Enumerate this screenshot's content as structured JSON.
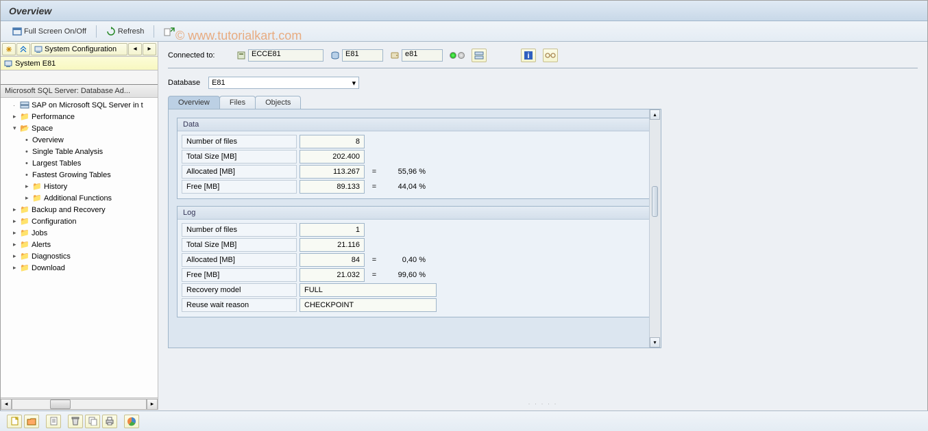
{
  "title": "Overview",
  "toolbar": {
    "fullscreen": "Full Screen On/Off",
    "refresh": "Refresh"
  },
  "sidebar": {
    "sys_config": "System Configuration",
    "system": "System E81",
    "tree_header": "Microsoft SQL Server: Database Ad...",
    "nodes": {
      "top": "SAP on Microsoft SQL Server in t",
      "performance": "Performance",
      "space": "Space",
      "overview": "Overview",
      "single_table": "Single Table Analysis",
      "largest": "Largest Tables",
      "fastest": "Fastest Growing Tables",
      "history": "History",
      "additional": "Additional Functions",
      "backup": "Backup and Recovery",
      "configuration": "Configuration",
      "jobs": "Jobs",
      "alerts": "Alerts",
      "diagnostics": "Diagnostics",
      "download": "Download"
    }
  },
  "conn": {
    "label": "Connected to:",
    "field1": "ECCE81",
    "field2": "E81",
    "field3": "e81"
  },
  "db": {
    "label": "Database",
    "value": "E81"
  },
  "tabs": {
    "overview": "Overview",
    "files": "Files",
    "objects": "Objects"
  },
  "data_group": {
    "title": "Data",
    "num_files_label": "Number of files",
    "num_files": "8",
    "total_size_label": "Total Size [MB]",
    "total_size": "202.400",
    "allocated_label": "Allocated [MB]",
    "allocated": "113.267",
    "allocated_pct": "55,96 %",
    "free_label": "Free [MB]",
    "free": "89.133",
    "free_pct": "44,04 %"
  },
  "log_group": {
    "title": "Log",
    "num_files_label": "Number of files",
    "num_files": "1",
    "total_size_label": "Total Size [MB]",
    "total_size": "21.116",
    "allocated_label": "Allocated [MB]",
    "allocated": "84",
    "allocated_pct": "0,40 %",
    "free_label": "Free [MB]",
    "free": "21.032",
    "free_pct": "99,60 %",
    "recovery_label": "Recovery model",
    "recovery": "FULL",
    "reuse_label": "Reuse wait reason",
    "reuse": "CHECKPOINT"
  },
  "eq": "=",
  "watermark": "© www.tutorialkart.com"
}
